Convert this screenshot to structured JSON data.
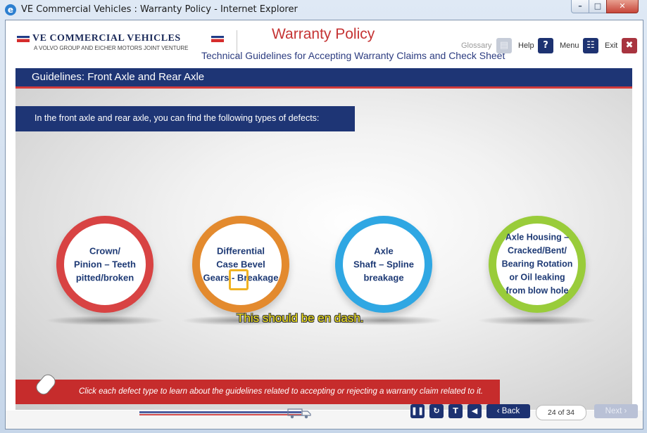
{
  "window": {
    "title": "VE Commercial Vehicles : Warranty Policy - Internet Explorer"
  },
  "header": {
    "logo_main": "VE COMMERCIAL VEHICLES",
    "logo_sub": "A VOLVO GROUP AND EICHER MOTORS JOINT VENTURE",
    "title": "Warranty Policy",
    "subtitle": "Technical Guidelines for Accepting Warranty Claims and Check Sheet",
    "links": {
      "glossary": "Glossary",
      "help": "Help",
      "menu": "Menu",
      "exit": "Exit"
    }
  },
  "topic": {
    "title": "Guidelines: Front Axle and Rear Axle"
  },
  "intro": "In the front axle and rear axle, you can find the following types of defects:",
  "defects": [
    {
      "lines": [
        "Crown/",
        "Pinion – Teeth",
        "pitted/broken"
      ]
    },
    {
      "lines": [
        "Differential",
        "Case Bevel",
        "Gears - Breakage"
      ]
    },
    {
      "lines": [
        "Axle",
        "Shaft – Spline",
        "breakage"
      ]
    },
    {
      "lines": [
        "Axle Housing –",
        "Cracked/Bent/",
        "Bearing Rotation",
        "or Oil leaking",
        "from blow hole"
      ]
    }
  ],
  "callout": "This should be en dash.",
  "footer": {
    "instruction": "Click each defect type to learn about the guidelines related to accepting or rejecting a warranty claim related to it."
  },
  "nav": {
    "back": "Back",
    "page": "24 of 34",
    "next": "Next"
  },
  "colors": {
    "navy": "#1e3575",
    "red": "#c62c2c",
    "ring1": "#d84343",
    "ring2": "#e38a2e",
    "ring3": "#2fa7e3",
    "ring4": "#99cc3a"
  }
}
